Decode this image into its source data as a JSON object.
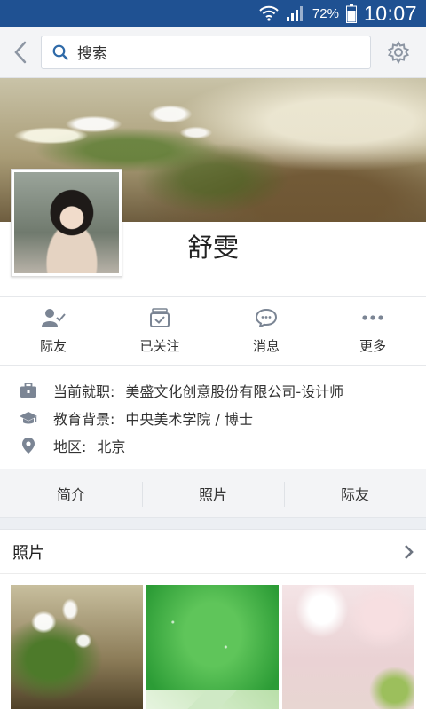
{
  "status_bar": {
    "battery_percent": "72%",
    "time": "10:07",
    "icons": [
      "wifi-icon",
      "signal-icon",
      "battery-icon"
    ]
  },
  "topbar": {
    "search_placeholder": "搜索",
    "icons": [
      "back-arrow-icon",
      "search-icon",
      "gear-icon"
    ]
  },
  "profile": {
    "name": "舒雯"
  },
  "actions": [
    {
      "label": "际友",
      "icon": "contact-check-icon"
    },
    {
      "label": "已关注",
      "icon": "followed-box-icon"
    },
    {
      "label": "消息",
      "icon": "chat-bubble-icon"
    },
    {
      "label": "更多",
      "icon": "more-dots-icon"
    }
  ],
  "info": {
    "job_label": "当前就职:",
    "job_value": "美盛文化创意股份有限公司-设计师",
    "edu_label": "教育背景:",
    "edu_value": "中央美术学院 / 博士",
    "region_label": "地区:",
    "region_value": "北京"
  },
  "tabs": [
    "简介",
    "照片",
    "际友"
  ],
  "photos": {
    "title": "照片"
  },
  "colors": {
    "status_bar": "#1f5192",
    "icon_gray": "#7b8594",
    "background": "#eceff3"
  }
}
